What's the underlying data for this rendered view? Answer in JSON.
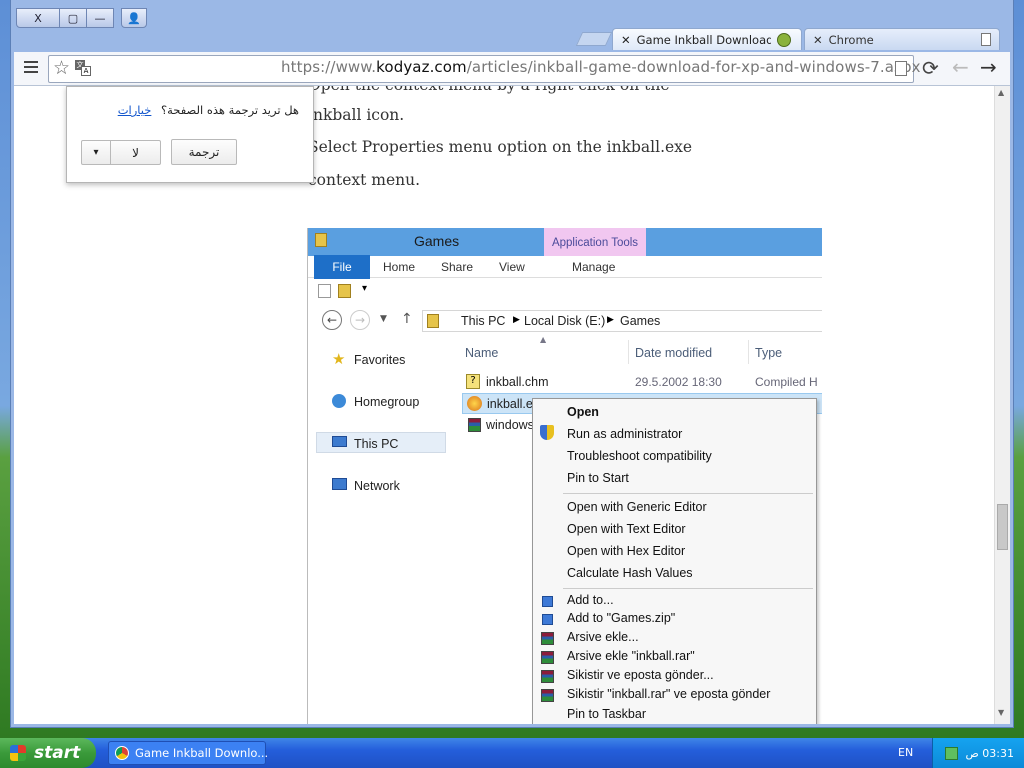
{
  "window": {
    "caption_buttons": [
      "X",
      "▢",
      "—",
      "👤"
    ]
  },
  "tabs": [
    {
      "label": "Game Inkball Download for V",
      "active": true
    },
    {
      "label": "Chrome",
      "active": false
    }
  ],
  "omnibox": {
    "url_prefix": "https://www.",
    "url_domain": "kodyaz.com",
    "url_path": "/articles/inkball-game-download-for-xp-and-windows-7.aspx"
  },
  "translate_bubble": {
    "question": "هل تريد ترجمة هذه الصفحة؟",
    "options_link": "خيارات",
    "translate_button": "ترجمة",
    "no_button": "لا",
    "dropdown_arrow": "▾"
  },
  "article": {
    "lines": [
      "Open the context menu by a right click on the",
      "inkball icon.",
      "Select Properties menu option on the inkball.exe",
      "context menu."
    ]
  },
  "explorer": {
    "title": "Games",
    "app_tools": "Application Tools",
    "ribbon_tabs": [
      "File",
      "Home",
      "Share",
      "View",
      "Manage"
    ],
    "address": [
      "This PC",
      "Local Disk (E:)",
      "Games"
    ],
    "nav": [
      "Favorites",
      "Homegroup",
      "This PC",
      "Network"
    ],
    "columns": [
      "Name",
      "Date modified",
      "Type"
    ],
    "files": [
      {
        "name": "inkball.chm",
        "date": "29.5.2002 18:30",
        "type": "Compiled H"
      },
      {
        "name": "inkball.e",
        "date": "",
        "type": ""
      },
      {
        "name": "windows",
        "date": "",
        "type": ""
      }
    ]
  },
  "context_menu": {
    "group1": [
      "Open",
      "Run as administrator",
      "Troubleshoot compatibility",
      "Pin to Start"
    ],
    "group2": [
      "Open with Generic Editor",
      "Open with Text Editor",
      "Open with Hex Editor",
      "Calculate Hash Values"
    ],
    "group3": [
      "Add to...",
      "Add to  \"Games.zip\"",
      "Arsive ekle...",
      "Arsive ekle \"inkball.rar\"",
      "Sikistir ve eposta gönder...",
      "Sikistir \"inkball.rar\" ve eposta gönder",
      "Pin to Taskbar"
    ]
  },
  "taskbar": {
    "start": "start",
    "task": "Game Inkball Downlo...",
    "lang": "EN",
    "clock": "03:31 ص"
  }
}
